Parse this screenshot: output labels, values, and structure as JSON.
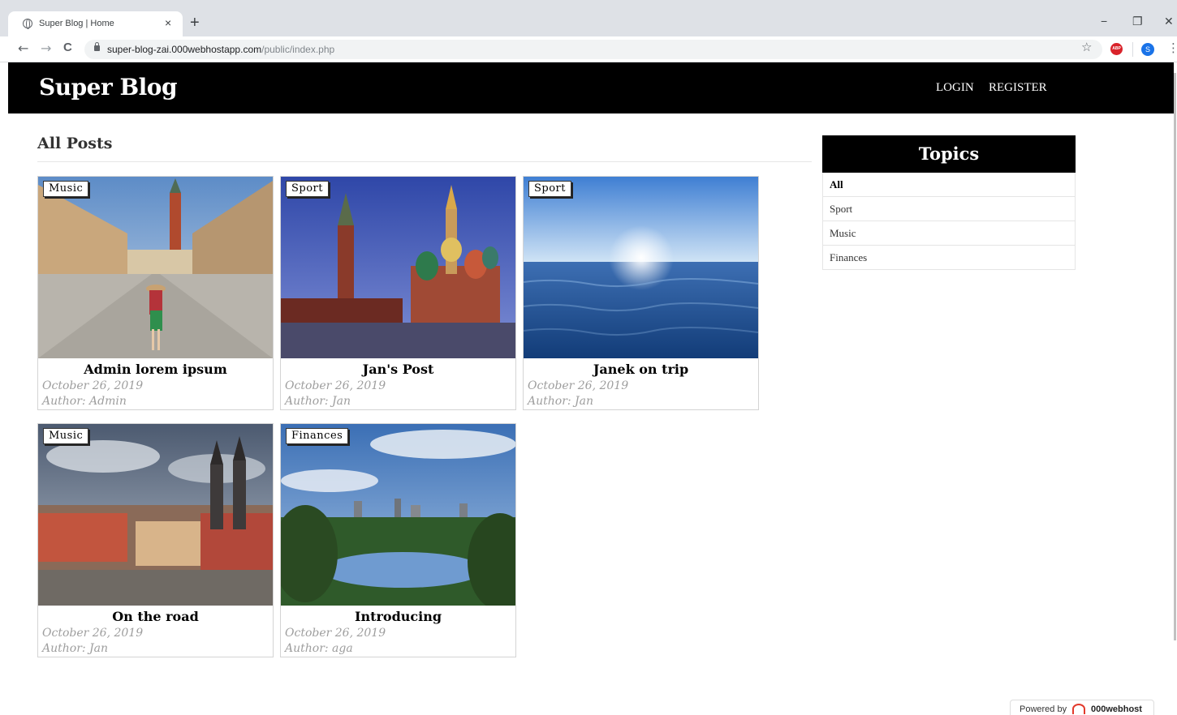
{
  "browser": {
    "tab_title": "Super Blog | Home",
    "tab_close": "×",
    "new_tab": "+",
    "url_host": "super-blog-zai.000webhostapp.com",
    "url_path": "/public/index.php",
    "window_controls": {
      "minimize": "−",
      "restore": "❐",
      "close": "✕"
    },
    "nav": {
      "back": "←",
      "forward": "→",
      "reload": "C"
    },
    "bookmark_icon": "☆",
    "extension_label": "ABP",
    "profile_initial": "S",
    "menu_icon": "⋮"
  },
  "site": {
    "brand": "Super Blog",
    "nav": {
      "login": "LOGIN",
      "register": "REGISTER"
    }
  },
  "main": {
    "title": "All Posts",
    "posts": [
      {
        "category": "Music",
        "title": "Admin lorem ipsum",
        "date": "October 26, 2019",
        "author": "Author: Admin",
        "image": "venice-square-photo"
      },
      {
        "category": "Sport",
        "title": "Jan's Post",
        "date": "October 26, 2019",
        "author": "Author: Jan",
        "image": "moscow-cathedral-photo"
      },
      {
        "category": "Sport",
        "title": "Janek on trip",
        "date": "October 26, 2019",
        "author": "Author: Jan",
        "image": "sea-sunrise-photo"
      },
      {
        "category": "Music",
        "title": "On the road",
        "date": "October 26, 2019",
        "author": "Author: Jan",
        "image": "prague-old-town-photo"
      },
      {
        "category": "Finances",
        "title": "Introducing",
        "date": "October 26, 2019",
        "author": "Author: aga",
        "image": "central-park-lake-photo"
      }
    ]
  },
  "sidebar": {
    "title": "Topics",
    "items": [
      {
        "label": "All",
        "active": true
      },
      {
        "label": "Sport",
        "active": false
      },
      {
        "label": "Music",
        "active": false
      },
      {
        "label": "Finances",
        "active": false
      }
    ]
  },
  "footer_badge": {
    "powered_by": "Powered by",
    "brand": "000webhost"
  }
}
